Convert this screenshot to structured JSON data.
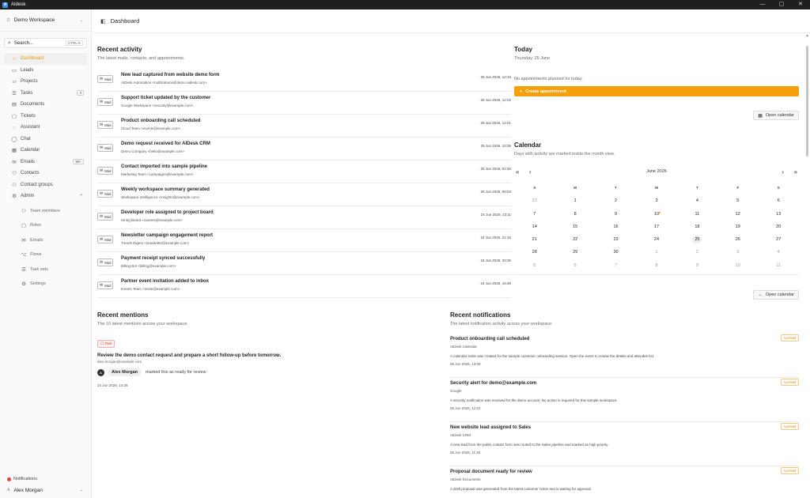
{
  "window": {
    "title": "AIdesk",
    "app_icon": "A"
  },
  "sidebar": {
    "workspace": {
      "initial": "D",
      "name": "Demo Workspace"
    },
    "search": {
      "label": "Search...",
      "shortcut": "CTRL K"
    },
    "items": [
      {
        "key": "dashboard",
        "label": "Dashboard",
        "icon": "home-icon",
        "glyph": "⌂",
        "active": true
      },
      {
        "key": "leads",
        "label": "Leads",
        "icon": "inbox-icon",
        "glyph": "▭"
      },
      {
        "key": "projects",
        "label": "Projects",
        "icon": "folder-icon",
        "glyph": "▱"
      },
      {
        "key": "tasks",
        "label": "Tasks",
        "icon": "checklist-icon",
        "glyph": "☰",
        "badge": "3"
      },
      {
        "key": "documents",
        "label": "Documents",
        "icon": "document-icon",
        "glyph": "▤"
      },
      {
        "key": "tickets",
        "label": "Tickets",
        "icon": "ticket-icon",
        "glyph": "▢"
      },
      {
        "key": "assistant",
        "label": "Assistant",
        "icon": "assistant-icon",
        "glyph": "◌"
      },
      {
        "key": "chat",
        "label": "Chat",
        "icon": "chat-icon",
        "glyph": "◯"
      },
      {
        "key": "calendar",
        "label": "Calendar",
        "icon": "calendar-icon",
        "glyph": "▦"
      },
      {
        "key": "emails",
        "label": "Emails",
        "icon": "mail-icon",
        "glyph": "✉",
        "badge": "99+"
      },
      {
        "key": "contacts",
        "label": "Contacts",
        "icon": "contact-icon",
        "glyph": "⚇"
      },
      {
        "key": "contact-groups",
        "label": "Contact groups",
        "icon": "group-icon",
        "glyph": "⚇"
      },
      {
        "key": "admin",
        "label": "Admin",
        "icon": "admin-icon",
        "glyph": "⚙",
        "expanded": true
      }
    ],
    "admin_items": [
      {
        "key": "team-members",
        "label": "Team members",
        "icon": "team-icon",
        "glyph": "⚇"
      },
      {
        "key": "roles",
        "label": "Roles",
        "icon": "roles-icon",
        "glyph": "▢"
      },
      {
        "key": "admin-emails",
        "label": "Emails",
        "icon": "mail-icon",
        "glyph": "✉"
      },
      {
        "key": "flows",
        "label": "Flows",
        "icon": "flow-icon",
        "glyph": "⌥"
      },
      {
        "key": "task-sets",
        "label": "Task sets",
        "icon": "taskset-icon",
        "glyph": "☰"
      },
      {
        "key": "settings",
        "label": "Settings",
        "icon": "gear-icon",
        "glyph": "⚙"
      }
    ],
    "notifications_label": "Notifications",
    "user": {
      "initial": "A",
      "name": "Alex Morgan"
    }
  },
  "header": {
    "title": "Dashboard"
  },
  "recent_activity": {
    "title": "Recent activity",
    "subtitle": "The latest mails, contacts, and appointments.",
    "tag_label": "Mail",
    "items": [
      {
        "subject": "New lead captured from website demo form",
        "from": "AIDesk Automation <notifications@demo-aidesk.com>",
        "date": "25 Jun 2026, 12:33"
      },
      {
        "subject": "Support ticket updated by the customer",
        "from": "Google Workspace <security@example.com>",
        "date": "25 Jun 2026, 12:02"
      },
      {
        "subject": "Product onboarding call scheduled",
        "from": "Cloud Team <events@example.com>",
        "date": "25 Jun 2026, 12:01"
      },
      {
        "subject": "Demo request received for AIDesk CRM",
        "from": "Demo Company <hello@example.com>",
        "date": "25 Jun 2026, 10:06"
      },
      {
        "subject": "Contact imported into sample pipeline",
        "from": "Marketing Team <campaigns@example.com>",
        "date": "25 Jun 2026, 01:00"
      },
      {
        "subject": "Weekly workspace summary generated",
        "from": "Workspace Intelligence <insights@example.com>",
        "date": "25 Jun 2026, 00:04"
      },
      {
        "subject": "Developer role assigned to project board",
        "from": "Hiring Board <careers@example.com>",
        "date": "24 Jun 2026, 23:11"
      },
      {
        "subject": "Newsletter campaign engagement report",
        "from": "Trends Digest <newsletter@example.com>",
        "date": "24 Jun 2026, 21:15"
      },
      {
        "subject": "Payment receipt synced successfully",
        "from": "Billing Bot <billing@example.com>",
        "date": "24 Jun 2026, 20:35"
      },
      {
        "subject": "Partner event invitation added to inbox",
        "from": "Events Team <invite@example.com>",
        "date": "24 Jun 2026, 19:49"
      }
    ]
  },
  "today": {
    "title": "Today",
    "date": "Thursday, 25 June",
    "empty": "No appointments planned for today.",
    "create_label": "Create appointment",
    "open_calendar_label": "Open calendar"
  },
  "calendar": {
    "title": "Calendar",
    "subtitle": "Days with activity are marked inside the month view.",
    "month": "June 2026",
    "weekdays": [
      "S",
      "M",
      "T",
      "W",
      "T",
      "F",
      "S"
    ],
    "weeks": [
      [
        {
          "d": "31",
          "m": true
        },
        {
          "d": "1"
        },
        {
          "d": "2"
        },
        {
          "d": "3"
        },
        {
          "d": "4"
        },
        {
          "d": "5"
        },
        {
          "d": "6"
        }
      ],
      [
        {
          "d": "7"
        },
        {
          "d": "8"
        },
        {
          "d": "9"
        },
        {
          "d": "10",
          "e": true
        },
        {
          "d": "11"
        },
        {
          "d": "12"
        },
        {
          "d": "13"
        }
      ],
      [
        {
          "d": "14"
        },
        {
          "d": "15"
        },
        {
          "d": "16"
        },
        {
          "d": "17"
        },
        {
          "d": "18"
        },
        {
          "d": "19"
        },
        {
          "d": "20"
        }
      ],
      [
        {
          "d": "21"
        },
        {
          "d": "22"
        },
        {
          "d": "23"
        },
        {
          "d": "24"
        },
        {
          "d": "25",
          "t": true
        },
        {
          "d": "26"
        },
        {
          "d": "27"
        }
      ],
      [
        {
          "d": "28"
        },
        {
          "d": "29"
        },
        {
          "d": "30"
        },
        {
          "d": "1",
          "m": true
        },
        {
          "d": "2",
          "m": true
        },
        {
          "d": "3",
          "m": true
        },
        {
          "d": "4",
          "m": true
        }
      ],
      [
        {
          "d": "5",
          "m": true
        },
        {
          "d": "6",
          "m": true
        },
        {
          "d": "7",
          "m": true
        },
        {
          "d": "8",
          "m": true
        },
        {
          "d": "9",
          "m": true
        },
        {
          "d": "10",
          "m": true
        },
        {
          "d": "11",
          "m": true
        }
      ]
    ],
    "open_calendar_label": "Open calendar"
  },
  "mentions": {
    "title": "Recent mentions",
    "subtitle": "The 10 latest mentions across your workspace.",
    "items": [
      {
        "tag": "Task",
        "title": "Review the demo contact request and prepare a short follow-up before tomorrow.",
        "email": "alex.morgan@example.com",
        "actor_initial": "A",
        "actor": "Alex Morgan",
        "action": "marked this as ready for review",
        "date": "24 Jun 2026, 14:28"
      }
    ]
  },
  "notifications": {
    "title": "Recent notifications",
    "subtitle": "The latest notification activity across your workspace.",
    "unread_label": "Unread",
    "items": [
      {
        "title": "Product onboarding call scheduled",
        "source": "AIDesk Calendar",
        "body": "A calendar invite was created for the sample customer onboarding session. Open the event to review the details and attendee list.",
        "date": "25 Jun 2026, 13:00"
      },
      {
        "title": "Security alert for demo@example.com",
        "source": "Google",
        "body": "A security notification was received for the demo account. No action is required for this sample workspace.",
        "date": "25 Jun 2026, 12:02"
      },
      {
        "title": "New website lead assigned to Sales",
        "source": "AIDesk CRM",
        "body": "A new lead from the public contact form was routed to the Sales pipeline and marked as high priority.",
        "date": "25 Jun 2026, 11:45"
      },
      {
        "title": "Proposal document ready for review",
        "source": "AIDesk Documents",
        "body": "A draft proposal was generated from the latest customer notes and is waiting for approval.",
        "date": ""
      }
    ]
  },
  "colors": {
    "accent": "#f5a00a",
    "active_nav": "#e59a12",
    "unread": "#d58a10",
    "task_tag": "#d5443a"
  }
}
